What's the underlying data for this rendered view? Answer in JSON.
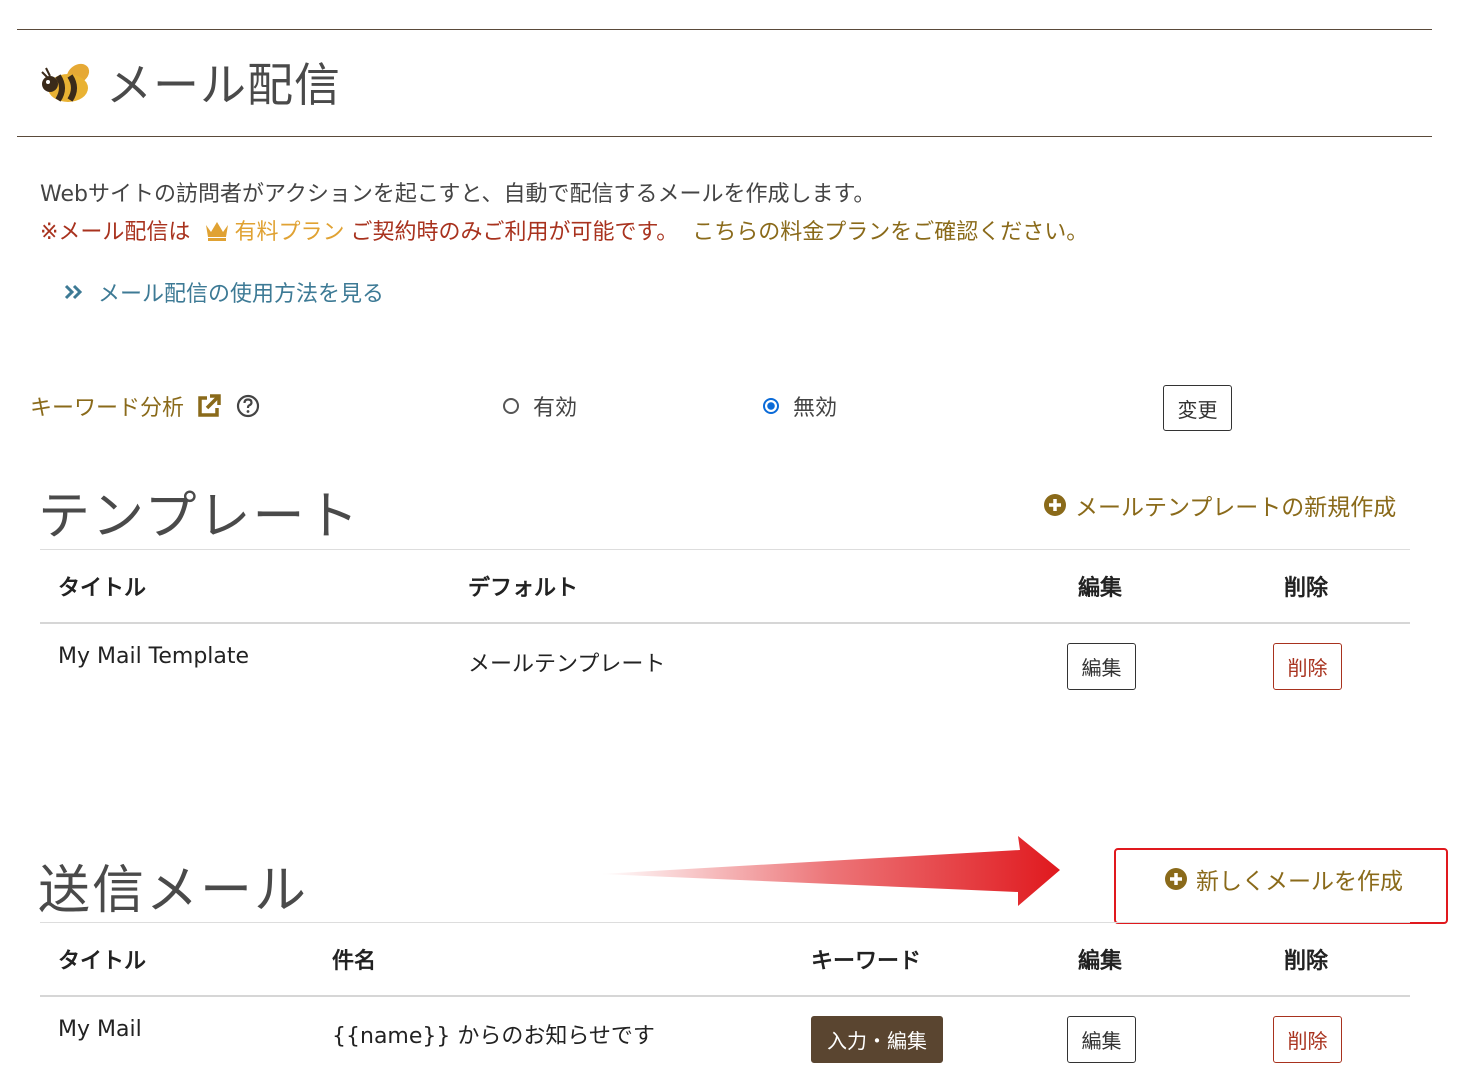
{
  "header": {
    "title": "メール配信"
  },
  "intro": {
    "description": "Webサイトの訪問者がアクションを起こすと、自動で配信するメールを作成します。",
    "notice_prefix": "※メール配信は",
    "plan_link": "有料プラン",
    "notice_middle": "ご契約時のみご利用が可能です。",
    "pricing_link": "こちらの料金プランをご確認ください。",
    "howto_link": "メール配信の使用方法を見る"
  },
  "keyword_analysis": {
    "label": "キーワード分析",
    "option_enabled": "有効",
    "option_disabled": "無効",
    "selected": "無効",
    "change_button": "変更"
  },
  "templates": {
    "section_title": "テンプレート",
    "create_link": "メールテンプレートの新規作成",
    "columns": {
      "title": "タイトル",
      "default": "デフォルト",
      "edit": "編集",
      "delete": "削除"
    },
    "rows": [
      {
        "title": "My Mail Template",
        "default": "メールテンプレート",
        "edit": "編集",
        "delete": "削除"
      }
    ]
  },
  "sent_mails": {
    "section_title": "送信メール",
    "create_link": "新しくメールを作成",
    "columns": {
      "title": "タイトル",
      "subject": "件名",
      "keyword": "キーワード",
      "edit": "編集",
      "delete": "削除"
    },
    "rows": [
      {
        "title": "My Mail",
        "subject": "{{name}} からのお知らせです",
        "keyword_button": "入力・編集",
        "edit": "編集",
        "delete": "削除"
      }
    ]
  },
  "colors": {
    "brand_brown": "#8a6a1a",
    "danger": "#a8321e",
    "plan_gold": "#e0a233",
    "link_blue": "#3d7a95",
    "radio_blue": "#0b6bd8",
    "annotation_red": "#e0191e"
  },
  "icons": {
    "logo": "bee-icon",
    "crown": "crown-icon",
    "howto": "double-chevron-right-icon",
    "external": "external-link-icon",
    "help": "question-circle-icon",
    "add": "plus-circle-icon",
    "annotation": "red-arrow-icon"
  }
}
